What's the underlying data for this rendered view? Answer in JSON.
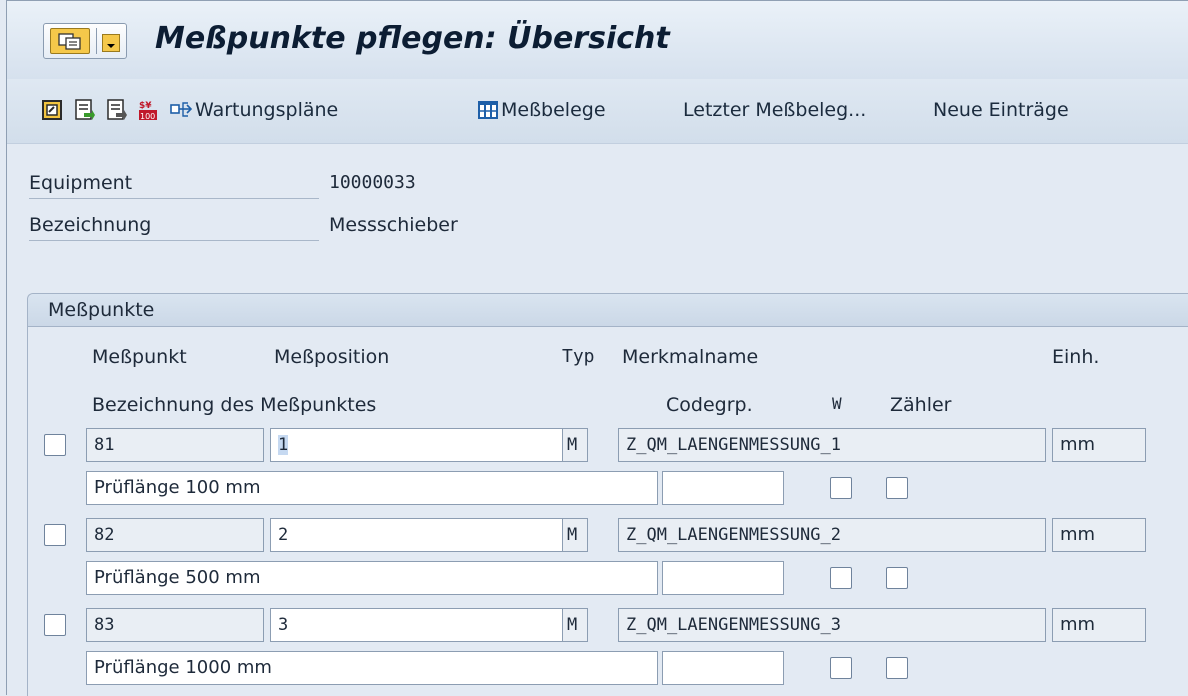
{
  "window": {
    "title": "Meßpunkte pflegen: Übersicht"
  },
  "toolbar": {
    "buttons": [
      {
        "icon": "display-change-icon"
      },
      {
        "icon": "previous-object-icon"
      },
      {
        "icon": "next-object-icon"
      },
      {
        "icon": "calculator-icon"
      },
      {
        "icon": "maintenance-plans-icon",
        "label": "Wartungspläne"
      },
      {
        "icon": "table-icon",
        "label": "Meßbelege"
      },
      {
        "label": "Letzter Meßbeleg..."
      },
      {
        "label": "Neue Einträge"
      }
    ]
  },
  "header": {
    "equipment_label": "Equipment",
    "equipment_value": "10000033",
    "description_label": "Bezeichnung",
    "description_value": "Messschieber"
  },
  "measuring_points": {
    "group_title": "Meßpunkte",
    "columns": {
      "point": "Meßpunkt",
      "position": "Meßposition",
      "type": "Typ",
      "characteristic": "Merkmalname",
      "unit": "Einh.",
      "description": "Bezeichnung des Meßpunktes",
      "codegroup": "Codegrp.",
      "w": "W",
      "counter": "Zähler"
    },
    "rows": [
      {
        "point": "81",
        "position": "1",
        "type": "M",
        "characteristic": "Z_QM_LAENGENMESSUNG_1",
        "unit": "mm",
        "description": "Prüflänge 100 mm",
        "codegroup": ""
      },
      {
        "point": "82",
        "position": "2",
        "type": "M",
        "characteristic": "Z_QM_LAENGENMESSUNG_2",
        "unit": "mm",
        "description": "Prüflänge 500 mm",
        "codegroup": ""
      },
      {
        "point": "83",
        "position": "3",
        "type": "M",
        "characteristic": "Z_QM_LAENGENMESSUNG_3",
        "unit": "mm",
        "description": "Prüflänge 1000 mm",
        "codegroup": ""
      }
    ]
  }
}
